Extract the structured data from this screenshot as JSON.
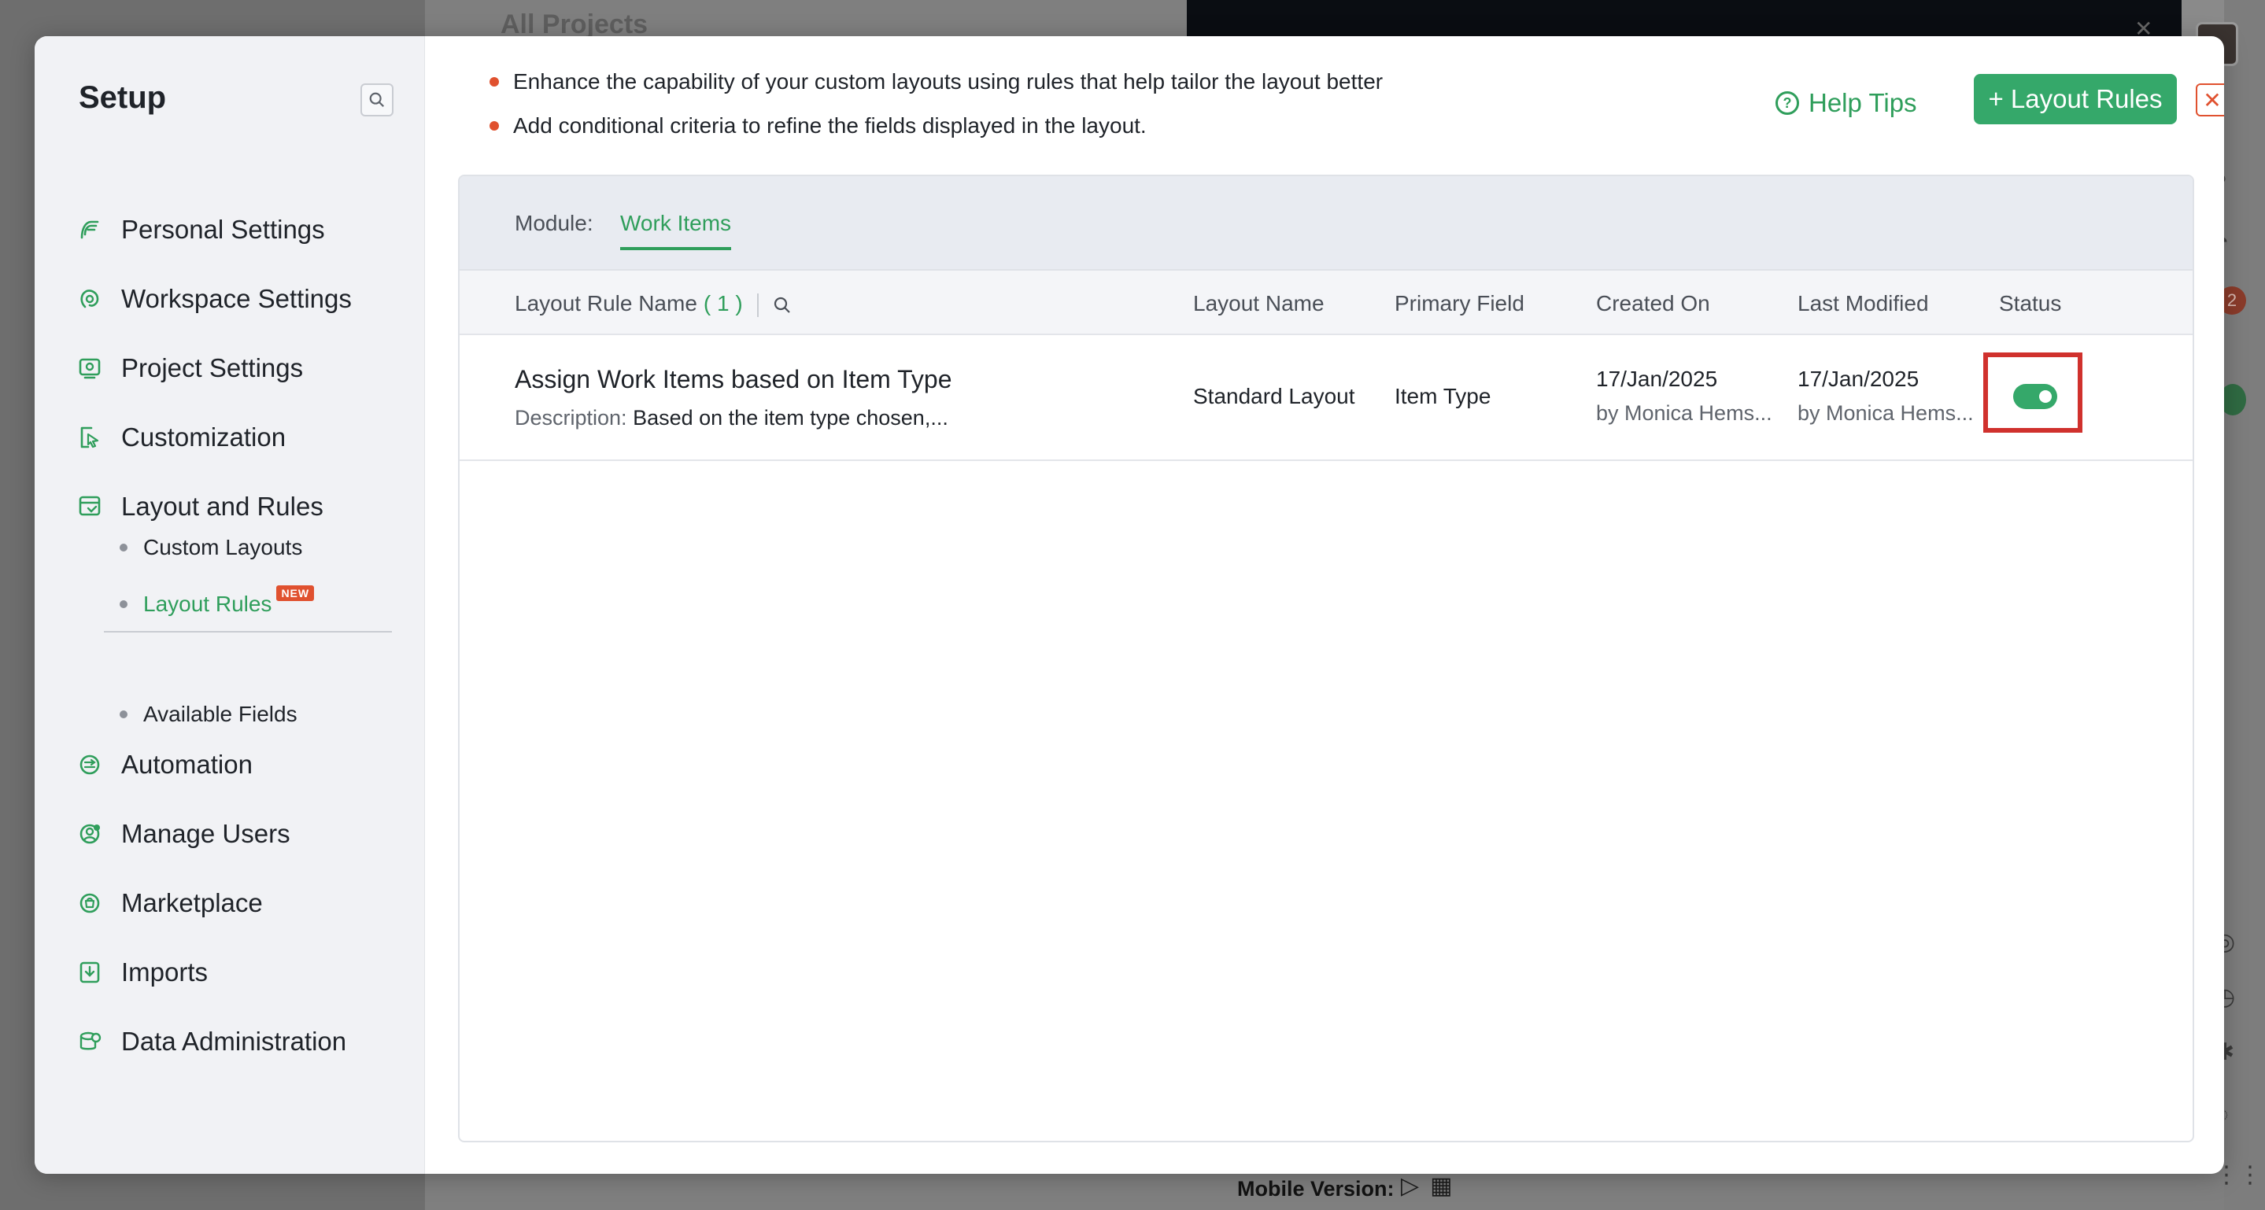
{
  "background": {
    "page_title": "All Projects",
    "footer_label": "Mobile Version:",
    "notification_count": "2"
  },
  "setup": {
    "title": "Setup",
    "nav": [
      {
        "label": "Personal Settings",
        "icon": "user-settings-icon"
      },
      {
        "label": "Workspace Settings",
        "icon": "workspace-icon"
      },
      {
        "label": "Project Settings",
        "icon": "project-settings-icon"
      },
      {
        "label": "Customization",
        "icon": "customization-icon"
      },
      {
        "label": "Layout and Rules",
        "icon": "layout-icon"
      },
      {
        "label": "Automation",
        "icon": "automation-icon"
      },
      {
        "label": "Manage Users",
        "icon": "users-icon"
      },
      {
        "label": "Marketplace",
        "icon": "marketplace-icon"
      },
      {
        "label": "Imports",
        "icon": "import-icon"
      },
      {
        "label": "Data Administration",
        "icon": "data-admin-icon"
      }
    ],
    "layout_sub": [
      {
        "label": "Custom Layouts"
      },
      {
        "label": "Layout Rules",
        "badge": "NEW",
        "active": true
      },
      {
        "label": "Available Fields"
      }
    ]
  },
  "main": {
    "info": [
      "Enhance the capability of your custom layouts using rules that help tailor the layout better",
      "Add conditional criteria to refine the fields displayed in the layout."
    ],
    "help_tips": "Help Tips",
    "add_button": "+ Layout Rules",
    "module_label": "Module:",
    "module_value": "Work Items",
    "columns": {
      "rule_name": "Layout Rule Name",
      "rule_count": "( 1 )",
      "layout_name": "Layout Name",
      "primary_field": "Primary Field",
      "created_on": "Created On",
      "last_modified": "Last Modified",
      "status": "Status"
    },
    "rows": [
      {
        "name": "Assign Work Items based on Item Type",
        "description_label": "Description:",
        "description": "Based on the item type chosen,...",
        "layout_name": "Standard Layout",
        "primary_field": "Item Type",
        "created_date": "17/Jan/2025",
        "created_by": "by Monica Hems...",
        "modified_date": "17/Jan/2025",
        "modified_by": "by Monica Hems...",
        "status_enabled": true
      }
    ]
  },
  "colors": {
    "accent": "#35a86a",
    "accent_text": "#2f9e5b",
    "alert": "#e0512f",
    "highlight": "#d0312d"
  }
}
